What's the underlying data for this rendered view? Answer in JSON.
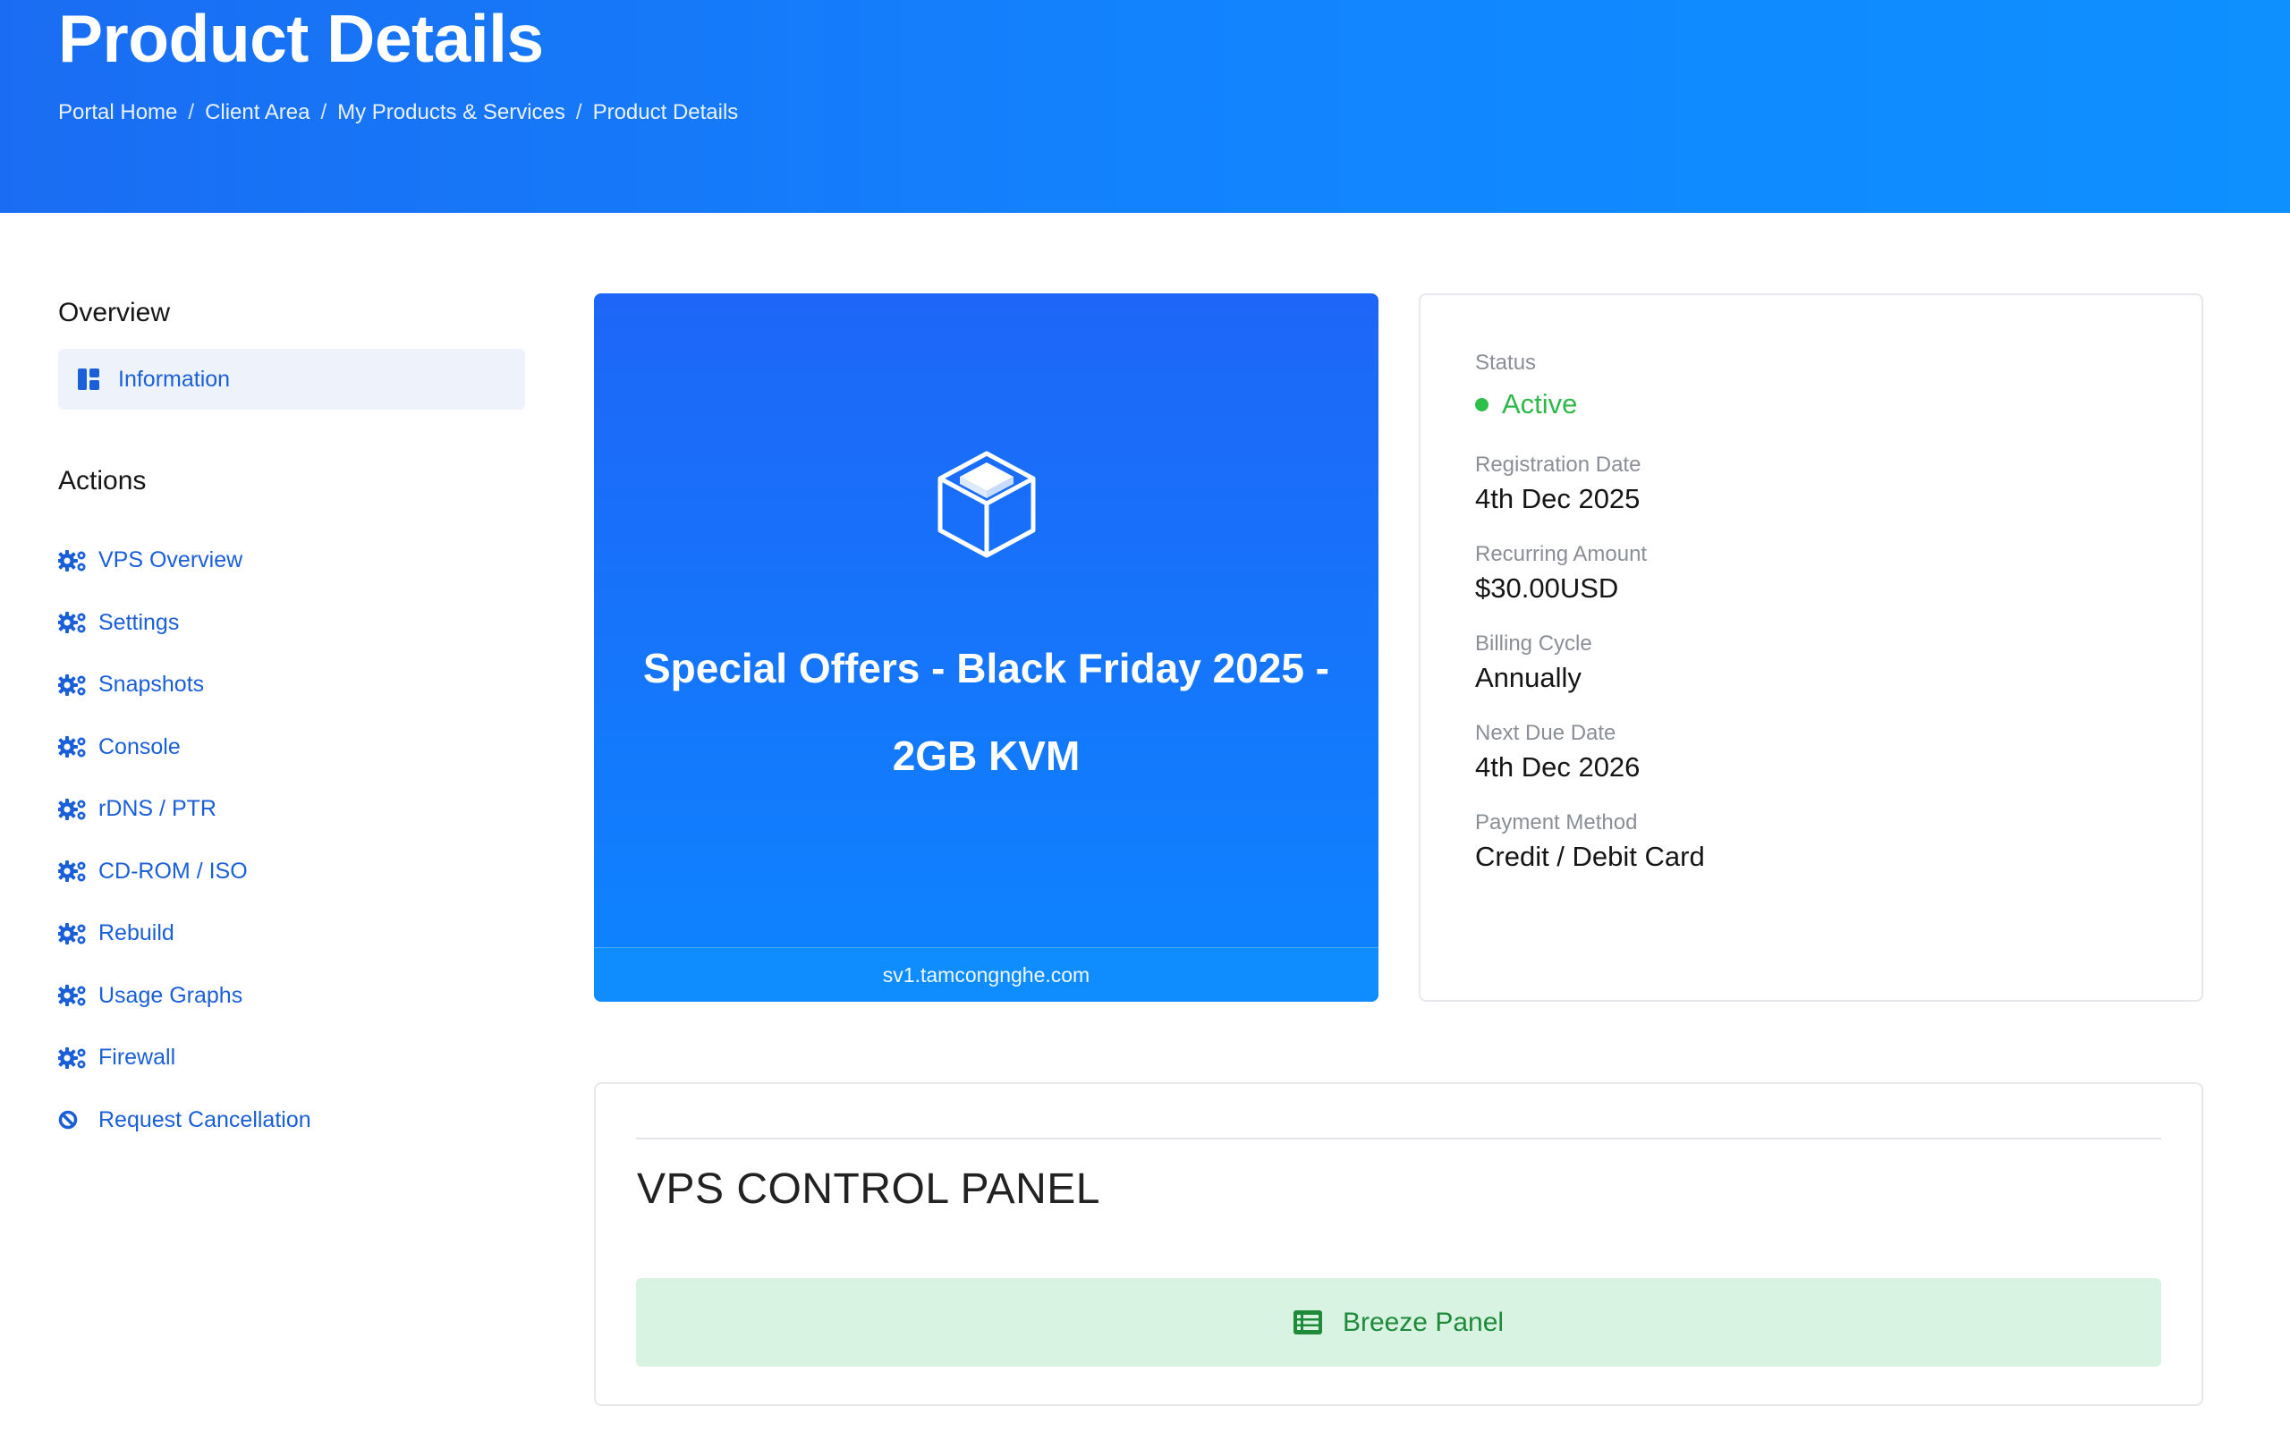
{
  "header": {
    "title": "Product Details",
    "breadcrumb": [
      "Portal Home",
      "Client Area",
      "My Products & Services",
      "Product Details"
    ],
    "separator": "/"
  },
  "sidebar": {
    "overview_heading": "Overview",
    "overview_items": [
      {
        "label": "Information",
        "icon": "dashboard-icon",
        "active": true
      }
    ],
    "actions_heading": "Actions",
    "actions": [
      {
        "label": "VPS Overview",
        "icon": "gears-icon"
      },
      {
        "label": "Settings",
        "icon": "gears-icon"
      },
      {
        "label": "Snapshots",
        "icon": "gears-icon"
      },
      {
        "label": "Console",
        "icon": "gears-icon"
      },
      {
        "label": "rDNS / PTR",
        "icon": "gears-icon"
      },
      {
        "label": "CD-ROM / ISO",
        "icon": "gears-icon"
      },
      {
        "label": "Rebuild",
        "icon": "gears-icon"
      },
      {
        "label": "Usage Graphs",
        "icon": "gears-icon"
      },
      {
        "label": "Firewall",
        "icon": "gears-icon"
      },
      {
        "label": "Request Cancellation",
        "icon": "ban-icon"
      }
    ]
  },
  "product": {
    "icon": "cube-icon",
    "name_line1": "Special Offers - Black Friday 2025 -",
    "name_line2": "2GB KVM",
    "hostname": "sv1.tamcongnghe.com"
  },
  "info": {
    "status_label": "Status",
    "status_value": "Active",
    "registration_label": "Registration Date",
    "registration_value": "4th Dec 2025",
    "recurring_label": "Recurring Amount",
    "recurring_value": "$30.00USD",
    "billing_label": "Billing Cycle",
    "billing_value": "Annually",
    "next_due_label": "Next Due Date",
    "next_due_value": "4th Dec 2026",
    "payment_label": "Payment Method",
    "payment_value": "Credit / Debit Card"
  },
  "control_panel": {
    "title": "VPS CONTROL PANEL",
    "button_label": "Breeze Panel",
    "button_icon": "list-icon"
  },
  "colors": {
    "header_blue": "#1186ff",
    "link_blue": "#1a5fd8",
    "status_green": "#2fb84a",
    "button_green_bg": "#d8f3e2"
  }
}
